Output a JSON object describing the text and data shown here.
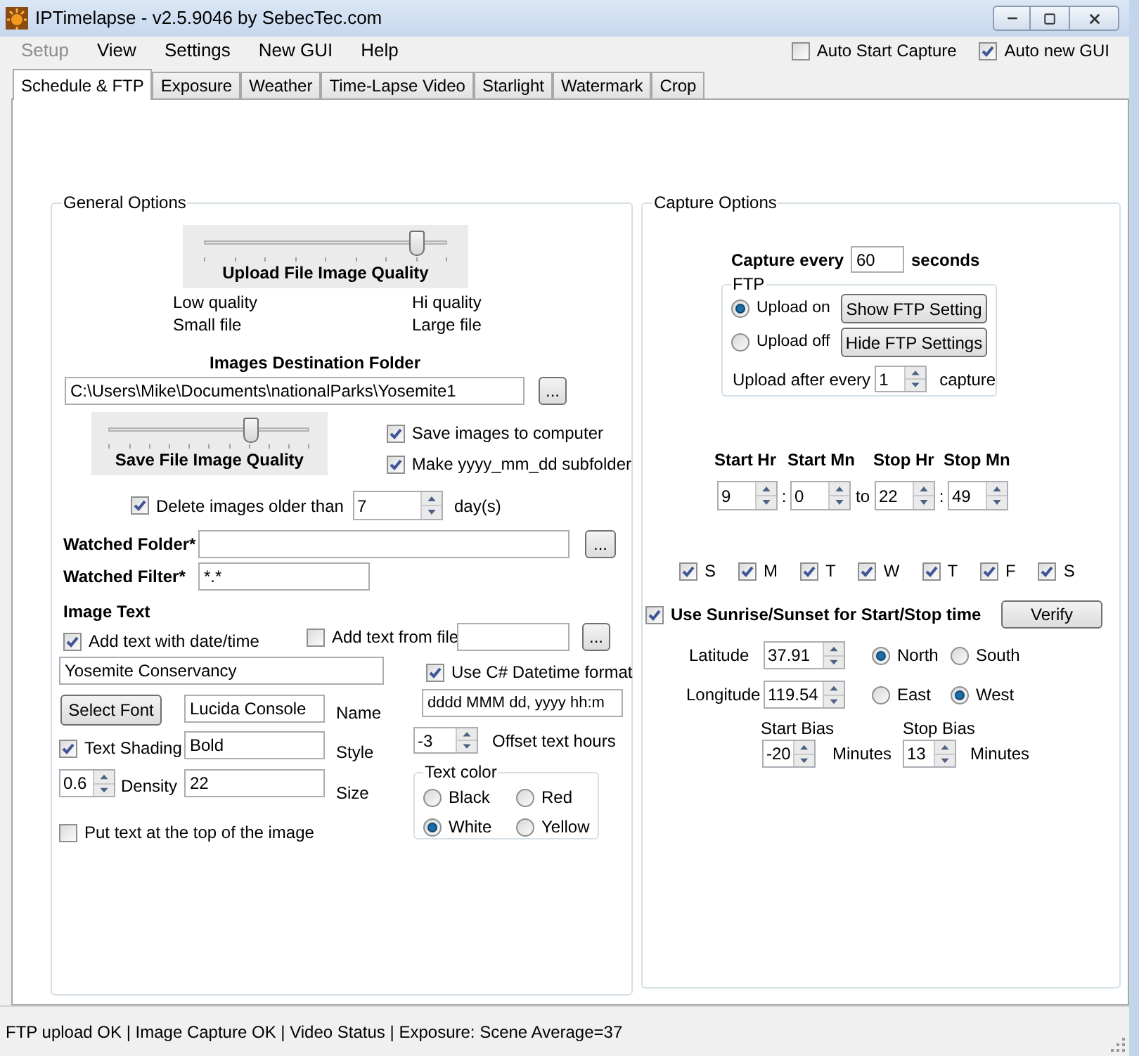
{
  "window": {
    "title": "IPTimelapse - v2.5.9046 by SebecTec.com"
  },
  "menu": [
    {
      "label": "Setup",
      "disabled": true
    },
    {
      "label": "View",
      "disabled": false
    },
    {
      "label": "Settings",
      "disabled": false
    },
    {
      "label": "New GUI",
      "disabled": false
    },
    {
      "label": "Help",
      "disabled": false
    }
  ],
  "header_options": [
    {
      "label": "Auto Start Capture",
      "checked": false
    },
    {
      "label": "Auto new GUI",
      "checked": true
    }
  ],
  "tabs": [
    {
      "label": "Schedule & FTP",
      "selected": true
    },
    {
      "label": "Exposure",
      "selected": false
    },
    {
      "label": "Weather",
      "selected": false
    },
    {
      "label": "Time-Lapse Video",
      "selected": false
    },
    {
      "label": "Starlight",
      "selected": false
    },
    {
      "label": "Watermark",
      "selected": false
    },
    {
      "label": "Crop",
      "selected": false
    }
  ],
  "general_options": {
    "title": "General Options",
    "upload_quality": {
      "title": "Upload File Image Quality",
      "level": 0.875,
      "low_labels": [
        "Low quality",
        "Small file"
      ],
      "high_labels": [
        "Hi quality",
        "Large file"
      ]
    },
    "destination": {
      "title": "Images Destination Folder",
      "value": "C:\\Users\\Mike\\Documents\\nationalParks\\Yosemite1",
      "browse": "..."
    },
    "save_quality": {
      "title": "Save File Image Quality",
      "level": 0.7
    },
    "save_images": {
      "label": "Save images to computer",
      "checked": true
    },
    "make_subfolder": {
      "label": "Make yyyy_mm_dd subfolder",
      "checked": true
    },
    "delete_old": {
      "label": "Delete images older than",
      "checked": true,
      "value": "7",
      "unit": "day(s)"
    },
    "watched_folder": {
      "label": "Watched Folder*",
      "browse": "..."
    },
    "watched_filter": {
      "label": "Watched Filter*",
      "value": "*.*"
    },
    "image_text": {
      "title": "Image Text",
      "add_datetime": {
        "label": "Add text with date/time",
        "checked": true
      },
      "add_from_file": {
        "label": "Add text from file",
        "checked": false,
        "browse": "..."
      },
      "text": "Yosemite Conservancy",
      "select_font": "Select Font",
      "font_name": {
        "value": "Lucida Console",
        "label": "Name"
      },
      "text_shading": {
        "label": "Text Shading",
        "checked": true
      },
      "font_style": {
        "value": "Bold",
        "label": "Style"
      },
      "density": {
        "value": "0.6",
        "label": "Density"
      },
      "font_size": {
        "value": "22",
        "label": "Size"
      },
      "top_of_image": {
        "label": "Put text at the top of the image",
        "checked": false
      },
      "csharp_format": {
        "label": "Use C# Datetime format",
        "checked": true,
        "value": "dddd MMM dd, yyyy  hh:m"
      },
      "offset": {
        "value": "-3",
        "label": "Offset text hours"
      },
      "text_color": {
        "title": "Text color",
        "options": [
          {
            "label": "Black",
            "selected": false
          },
          {
            "label": "Red",
            "selected": false
          },
          {
            "label": "White",
            "selected": true
          },
          {
            "label": "Yellow",
            "selected": false
          }
        ]
      }
    }
  },
  "capture_options": {
    "title": "Capture Options",
    "capture_every": {
      "label": "Capture every",
      "value": "60",
      "unit": "seconds"
    },
    "ftp": {
      "title": "FTP",
      "modes": [
        {
          "label": "Upload on",
          "selected": true,
          "button": "Show FTP Setting"
        },
        {
          "label": "Upload off",
          "selected": false,
          "button": "Hide FTP Settings"
        }
      ],
      "upload_after": {
        "label": "Upload after every",
        "value": "1",
        "unit": "capture"
      }
    },
    "schedule": {
      "fields": [
        {
          "label": "Start Hr",
          "value": "9"
        },
        {
          "label": "Start Mn",
          "value": "0"
        },
        {
          "label": "Stop Hr",
          "value": "22"
        },
        {
          "label": "Stop Mn",
          "value": "49"
        }
      ],
      "separators": [
        ":",
        "to",
        ":"
      ]
    },
    "days": [
      {
        "label": "S",
        "checked": true
      },
      {
        "label": "M",
        "checked": true
      },
      {
        "label": "T",
        "checked": true
      },
      {
        "label": "W",
        "checked": true
      },
      {
        "label": "T",
        "checked": true
      },
      {
        "label": "F",
        "checked": true
      },
      {
        "label": "S",
        "checked": true
      }
    ],
    "sunrise": {
      "label": "Use Sunrise/Sunset for Start/Stop time",
      "checked": true,
      "verify": "Verify",
      "latitude": {
        "label": "Latitude",
        "value": "37.91",
        "options": [
          {
            "label": "North",
            "selected": true
          },
          {
            "label": "South",
            "selected": false
          }
        ]
      },
      "longitude": {
        "label": "Longitude",
        "value": "119.54",
        "options": [
          {
            "label": "East",
            "selected": false
          },
          {
            "label": "West",
            "selected": true
          }
        ]
      },
      "start_bias": {
        "label": "Start Bias",
        "value": "-20",
        "unit": "Minutes"
      },
      "stop_bias": {
        "label": "Stop Bias",
        "value": "13",
        "unit": "Minutes"
      }
    }
  },
  "status_bar": "FTP upload OK | Image Capture OK | Video Status | Exposure: Scene Average=37"
}
